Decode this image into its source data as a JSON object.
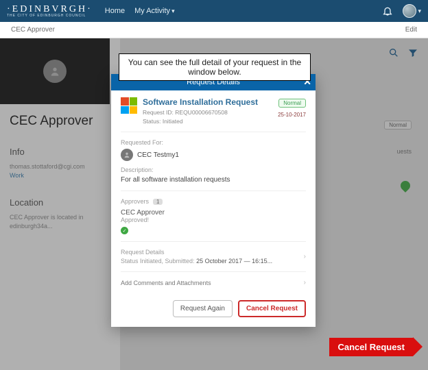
{
  "brand": {
    "name": "·EDINBVRGH·",
    "sub": "THE CITY OF EDINBURGH COUNCIL"
  },
  "nav": {
    "home": "Home",
    "activity": "My Activity"
  },
  "subheader": {
    "crumb": "CEC Approver",
    "edit": "Edit"
  },
  "left": {
    "name": "CEC Approver",
    "info_h": "Info",
    "email": "thomas.stottaford@cgi.com",
    "email_label": "Work",
    "location_h": "Location",
    "location_text": "CEC Approver is located in edinburgh34a..."
  },
  "right": {
    "bg_chip": "Normal",
    "bg_tag": "uests"
  },
  "callout": "You can see the full detail of your request in the window below.",
  "modal": {
    "header": "Request Details",
    "title": "Software Installation Request",
    "req_id_label": "Request ID:",
    "req_id": "REQU00006670508",
    "status_label": "Status:",
    "status_value": "Initiated",
    "priority": "Normal",
    "date": "25-10-2017",
    "requested_for_label": "Requested For:",
    "requested_for_name": "CEC Testmy1",
    "description_label": "Description:",
    "description_text": "For all software installation requests",
    "approvers_label": "Approvers",
    "approvers_count": "1",
    "approver_name": "CEC Approver",
    "approver_status": "Approved!",
    "details_label": "Request Details",
    "details_line_prefix": "Status Initiated, Submitted:",
    "details_date": "25 October 2017 — 16:15...",
    "comments_label": "Add Comments and Attachments",
    "btn_again": "Request Again",
    "btn_cancel": "Cancel Request"
  },
  "cta": "Cancel Request"
}
